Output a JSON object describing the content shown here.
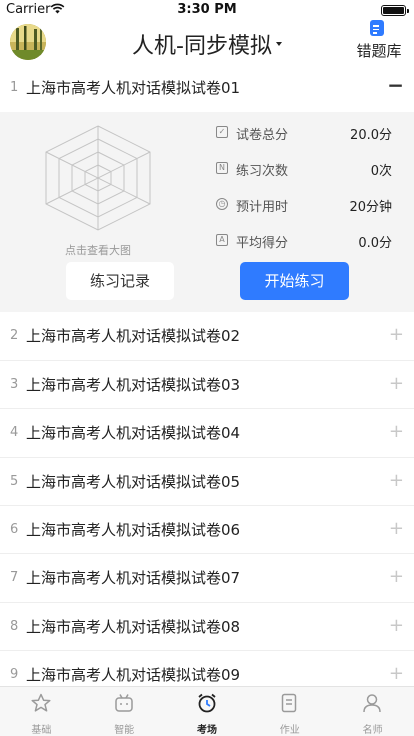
{
  "status_bar": {
    "carrier": "Carrier",
    "time": "3:30 PM"
  },
  "header": {
    "title": "人机-同步模拟",
    "wrong_book_label": "错题库"
  },
  "papers": [
    {
      "index": "1",
      "title": "上海市高考人机对话模拟试卷01",
      "expanded": true
    },
    {
      "index": "2",
      "title": "上海市高考人机对话模拟试卷02"
    },
    {
      "index": "3",
      "title": "上海市高考人机对话模拟试卷03"
    },
    {
      "index": "4",
      "title": "上海市高考人机对话模拟试卷04"
    },
    {
      "index": "5",
      "title": "上海市高考人机对话模拟试卷05"
    },
    {
      "index": "6",
      "title": "上海市高考人机对话模拟试卷06"
    },
    {
      "index": "7",
      "title": "上海市高考人机对话模拟试卷07"
    },
    {
      "index": "8",
      "title": "上海市高考人机对话模拟试卷08"
    },
    {
      "index": "9",
      "title": "上海市高考人机对话模拟试卷09"
    }
  ],
  "detail": {
    "radar_caption": "点击查看大图",
    "stats": [
      {
        "icon": "checkbox-icon",
        "label": "试卷总分",
        "value": "20.0分"
      },
      {
        "icon": "n-badge-icon",
        "label": "练习次数",
        "value": "0次"
      },
      {
        "icon": "clock-icon",
        "label": "预计用时",
        "value": "20分钟"
      },
      {
        "icon": "a-badge-icon",
        "label": "平均得分",
        "value": "0.0分"
      }
    ],
    "record_button": "练习记录",
    "start_button": "开始练习"
  },
  "tabs": [
    {
      "label": "基础",
      "icon": "star-icon",
      "active": false
    },
    {
      "label": "智能",
      "icon": "robot-tv-icon",
      "active": false
    },
    {
      "label": "考场",
      "icon": "alarm-clock-icon",
      "active": true
    },
    {
      "label": "作业",
      "icon": "document-icon",
      "active": false
    },
    {
      "label": "名师",
      "icon": "teacher-icon",
      "active": false
    }
  ],
  "colors": {
    "accent": "#2f7bff",
    "panel_bg": "#f4f4f4",
    "divider": "#eeeeee"
  }
}
